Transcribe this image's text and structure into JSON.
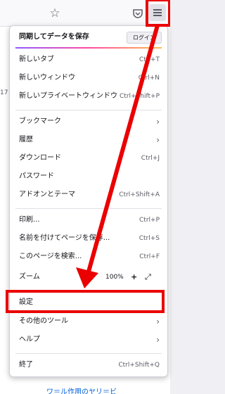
{
  "toolbar": {
    "star_icon": "star-icon",
    "pocket_icon": "pocket-icon",
    "menu_icon": "hamburger-menu-icon"
  },
  "background": {
    "side_number": "17",
    "bottom_text": "ワ＝ル作用のヤリ＝ビ"
  },
  "menu": {
    "sync_label": "同期してデータを保存",
    "login_button": "ログイン",
    "items": [
      {
        "label": "新しいタブ",
        "shortcut": "Ctrl+T"
      },
      {
        "label": "新しいウィンドウ",
        "shortcut": "Ctrl+N"
      },
      {
        "label": "新しいプライベートウィンドウ",
        "shortcut": "Ctrl+Shift+P"
      },
      {
        "label": "ブックマーク",
        "submenu": true
      },
      {
        "label": "履歴",
        "submenu": true
      },
      {
        "label": "ダウンロード",
        "shortcut": "Ctrl+J"
      },
      {
        "label": "パスワード",
        "shortcut": ""
      },
      {
        "label": "アドオンとテーマ",
        "shortcut": "Ctrl+Shift+A"
      },
      {
        "label": "印刷...",
        "shortcut": "Ctrl+P"
      },
      {
        "label": "名前を付けてページを保存...",
        "shortcut": "Ctrl+S"
      },
      {
        "label": "このページを検索...",
        "shortcut": "Ctrl+F"
      }
    ],
    "zoom": {
      "label": "ズーム",
      "minus": "−",
      "value": "100%",
      "plus": "+",
      "fullscreen": "⤢"
    },
    "settings": "設定",
    "more_tools": "その他のツール",
    "help": "ヘルプ",
    "quit": {
      "label": "終了",
      "shortcut": "Ctrl+Shift+Q"
    }
  },
  "colors": {
    "highlight": "#ea0000",
    "accent_link": "#0060df"
  }
}
